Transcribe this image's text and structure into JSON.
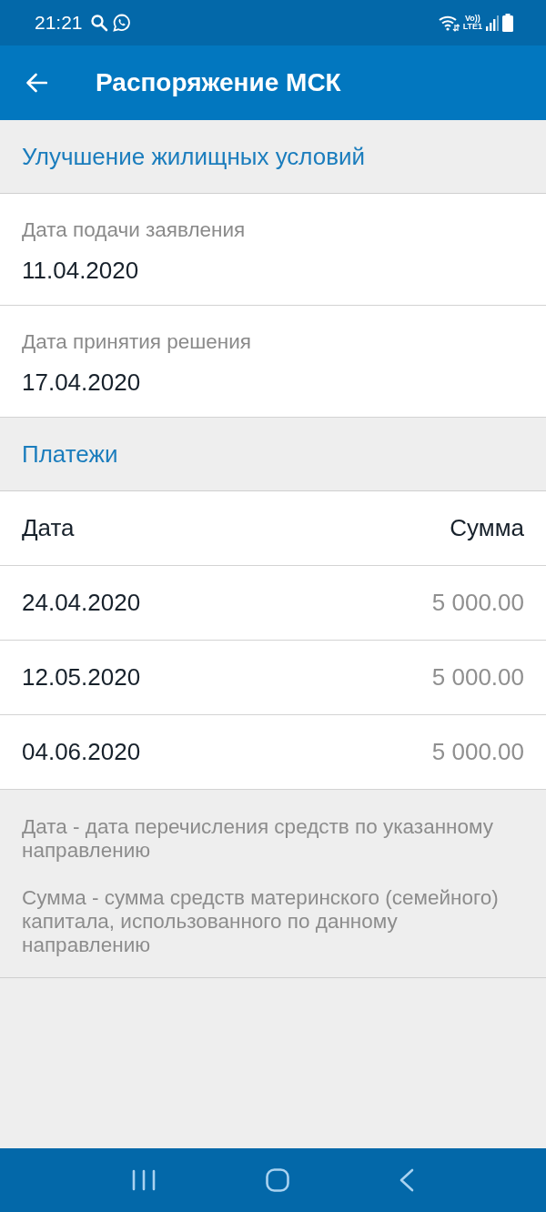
{
  "status_bar": {
    "time": "21:21",
    "volte": "Vo))",
    "network": "LTE1"
  },
  "app_bar": {
    "title": "Распоряжение МСК"
  },
  "sections": [
    {
      "kind": "fields",
      "title": "Улучшение жилищных условий",
      "fields": [
        {
          "label": "Дата подачи заявления",
          "value": "11.04.2020"
        },
        {
          "label": "Дата принятия решения",
          "value": "17.04.2020"
        }
      ]
    },
    {
      "kind": "table",
      "title": "Платежи",
      "columns": [
        "Дата",
        "Сумма"
      ],
      "rows": [
        [
          "24.04.2020",
          "5 000.00"
        ],
        [
          "12.05.2020",
          "5 000.00"
        ],
        [
          "04.06.2020",
          "5 000.00"
        ]
      ],
      "notes": [
        "Дата - дата перечисления средств по указанному направлению",
        "Сумма - сумма средств материнского (семейного) капитала, использованного по данному направлению"
      ]
    }
  ]
}
